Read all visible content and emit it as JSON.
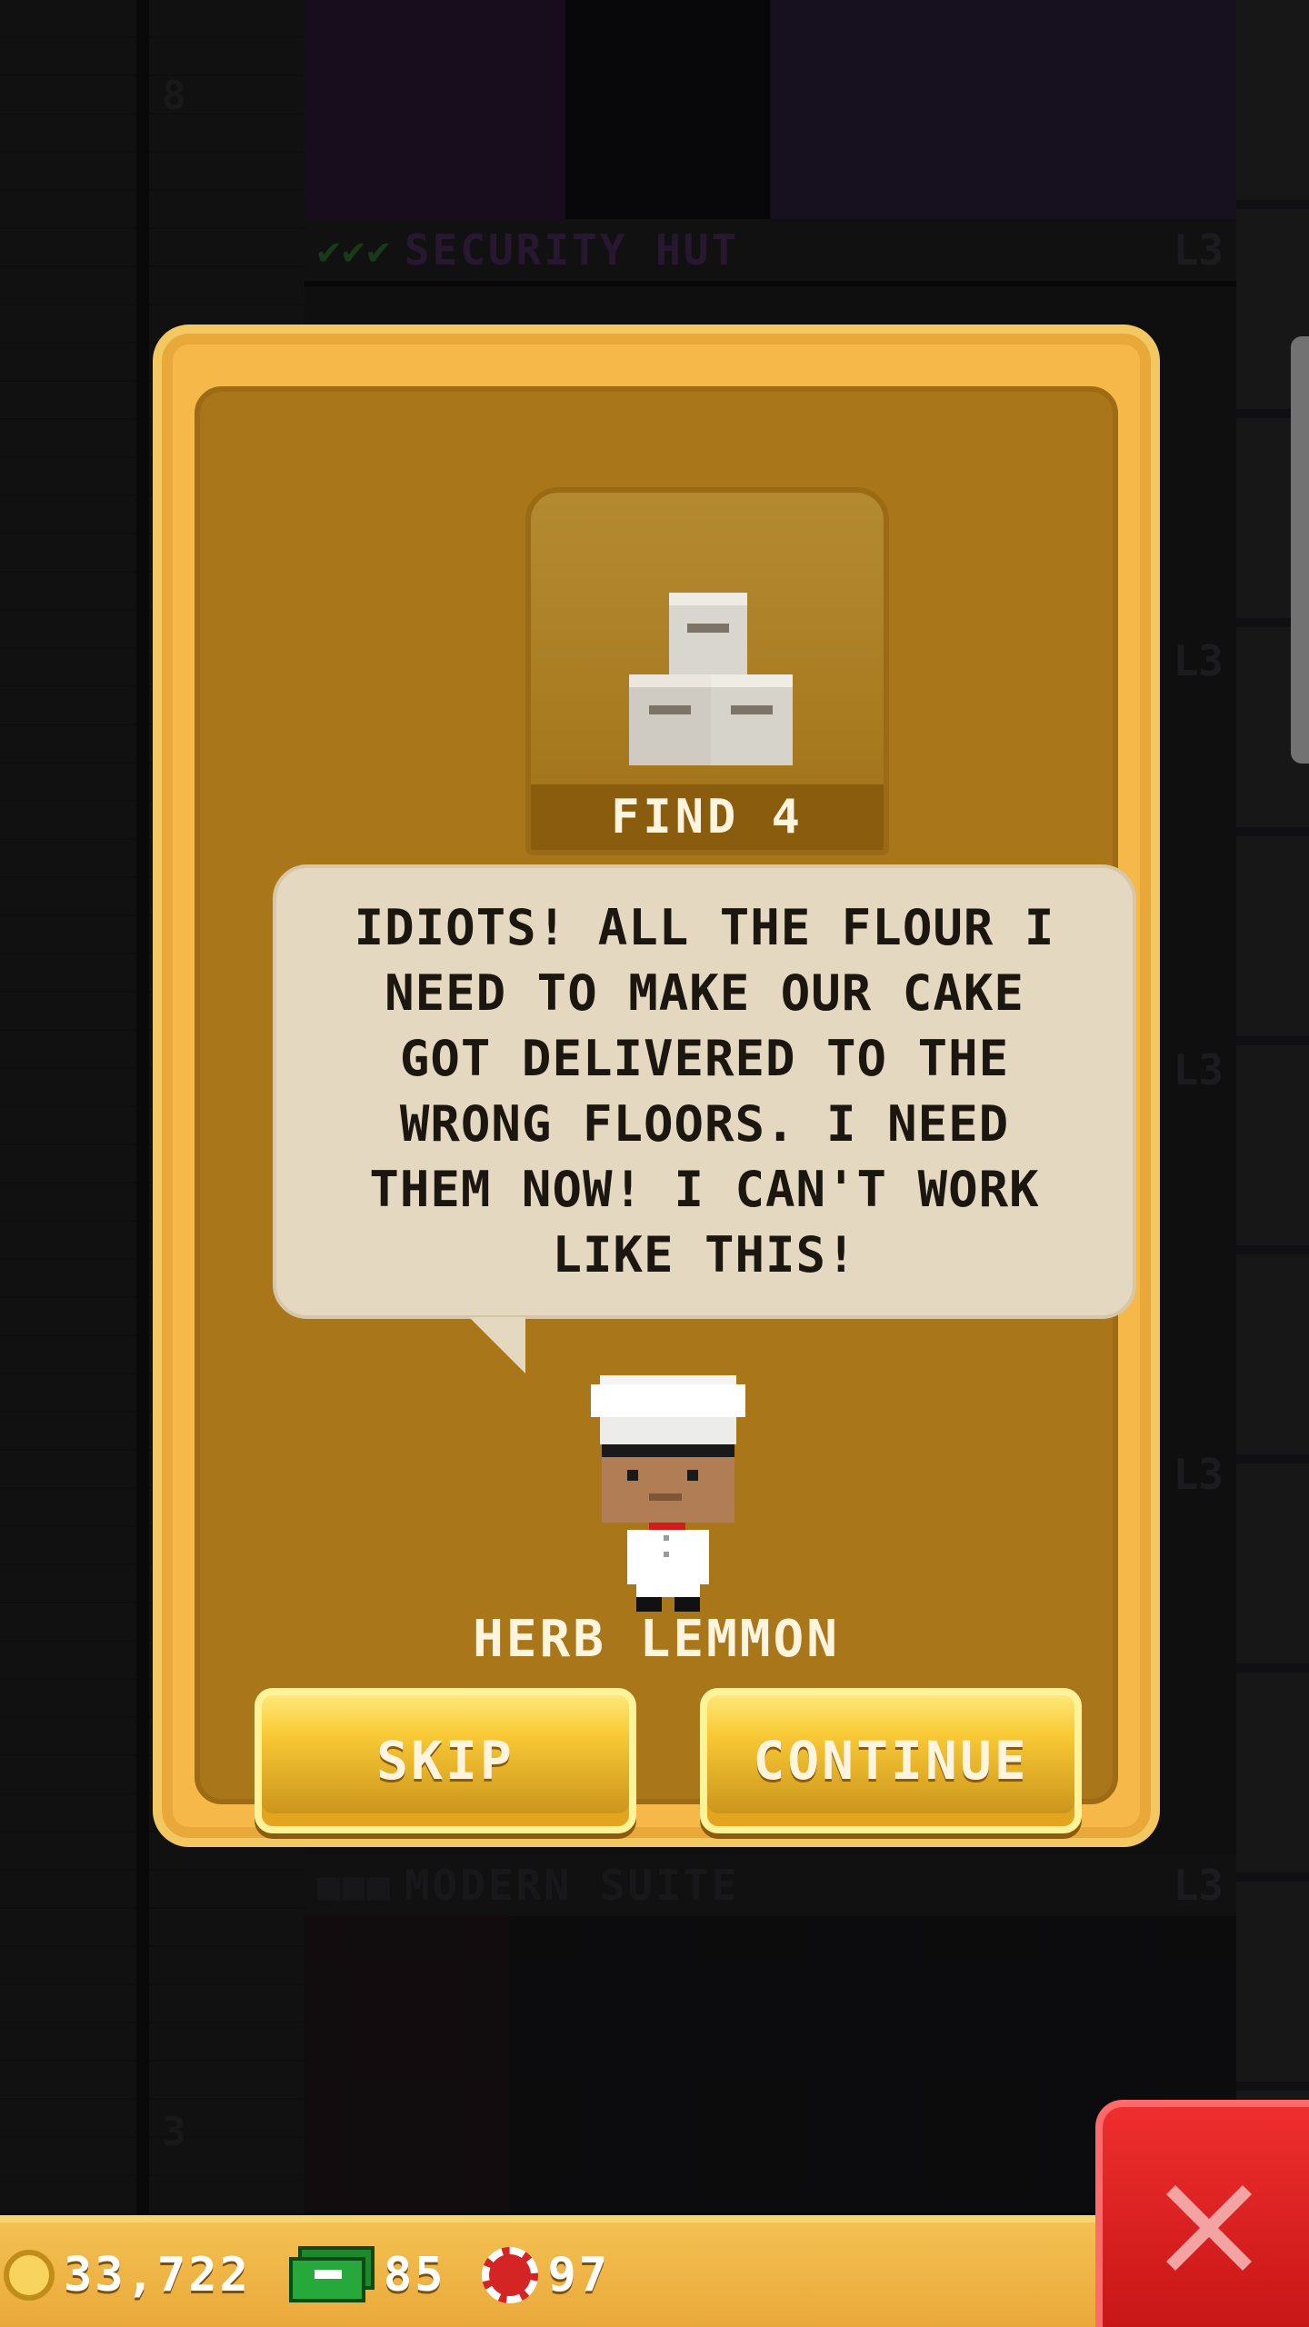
{
  "background": {
    "floors": [
      {
        "name": "SECURITY HUT",
        "level": "L3",
        "checks": "✔✔✔"
      },
      {
        "name": "MODERN SUITE",
        "level": "L3",
        "checks": "■■■"
      }
    ],
    "side_levels": [
      "L3",
      "L3",
      "L3"
    ],
    "elevator_numbers": [
      "8",
      "3"
    ]
  },
  "modal": {
    "quest": {
      "label": "FIND 4",
      "icon": "flour-bags-icon"
    },
    "dialog": "IDIOTS! ALL THE FLOUR I NEED TO MAKE OUR CAKE GOT DELIVERED TO THE WRONG FLOORS. I NEED THEM NOW! I CAN'T WORK LIKE THIS!",
    "character_name": "HERB LEMMON",
    "buttons": {
      "skip": "SKIP",
      "continue": "CONTINUE"
    }
  },
  "currency": {
    "coins": "33,722",
    "bux": "85",
    "chips": "97"
  },
  "colors": {
    "modal_gold": "#a9771a",
    "modal_border": "#f7b84a",
    "close_red": "#d71c1c",
    "bubble": "#e4d8c0"
  }
}
